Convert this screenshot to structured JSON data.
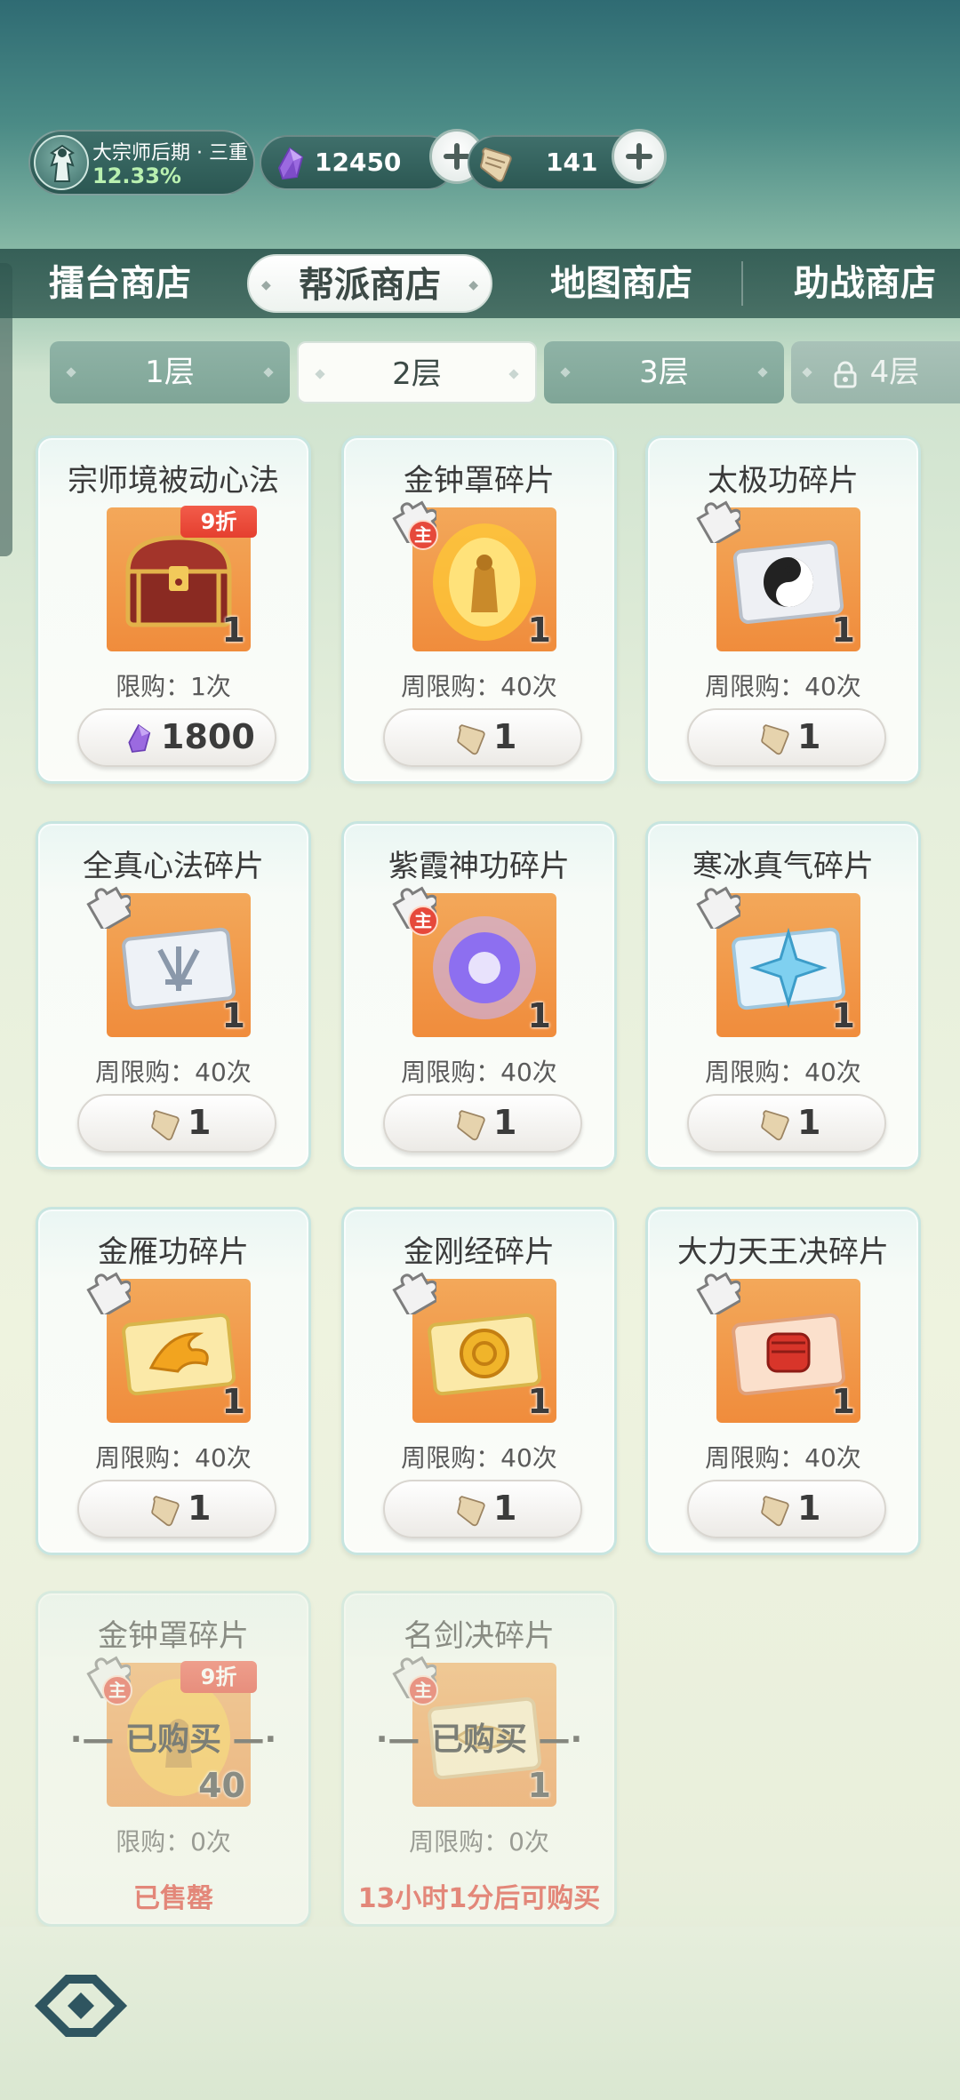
{
  "profile": {
    "rank": "大宗师后期 · 三重",
    "progress": "12.33%"
  },
  "currencies": [
    {
      "name": "purple-gem",
      "value": "12450"
    },
    {
      "name": "scroll-token",
      "value": "141"
    }
  ],
  "shop_tabs": [
    {
      "label": "擂台商店",
      "active": false
    },
    {
      "label": "帮派商店",
      "active": true
    },
    {
      "label": "地图商店",
      "active": false
    },
    {
      "label": "助战商店",
      "active": false
    }
  ],
  "floor_tabs": [
    {
      "label": "1层",
      "active": false,
      "locked": false
    },
    {
      "label": "2层",
      "active": true,
      "locked": false
    },
    {
      "label": "3层",
      "active": false,
      "locked": false
    },
    {
      "label": "4层",
      "active": false,
      "locked": true
    }
  ],
  "items": [
    {
      "title": "宗师境被动心法",
      "qty": "1",
      "limit": "限购：1次",
      "price": "1800",
      "currency": "purple-gem",
      "discount": "9折",
      "icon": "treasure-chest-icon"
    },
    {
      "title": "金钟罩碎片",
      "qty": "1",
      "limit": "周限购：40次",
      "price": "1",
      "currency": "scroll-token",
      "main_badge": "主",
      "icon": "golden-bell-icon"
    },
    {
      "title": "太极功碎片",
      "qty": "1",
      "limit": "周限购：40次",
      "price": "1",
      "currency": "scroll-token",
      "icon": "taiji-scroll-icon"
    },
    {
      "title": "全真心法碎片",
      "qty": "1",
      "limit": "周限购：40次",
      "price": "1",
      "currency": "scroll-token",
      "icon": "silver-scroll-icon"
    },
    {
      "title": "紫霞神功碎片",
      "qty": "1",
      "limit": "周限购：40次",
      "price": "1",
      "currency": "scroll-token",
      "main_badge": "主",
      "icon": "purple-orb-icon"
    },
    {
      "title": "寒冰真气碎片",
      "qty": "1",
      "limit": "周限购：40次",
      "price": "1",
      "currency": "scroll-token",
      "icon": "ice-scroll-icon"
    },
    {
      "title": "金雁功碎片",
      "qty": "1",
      "limit": "周限购：40次",
      "price": "1",
      "currency": "scroll-token",
      "icon": "golden-bird-scroll-icon"
    },
    {
      "title": "金刚经碎片",
      "qty": "1",
      "limit": "周限购：40次",
      "price": "1",
      "currency": "scroll-token",
      "icon": "golden-sutra-scroll-icon"
    },
    {
      "title": "大力天王决碎片",
      "qty": "1",
      "limit": "周限购：40次",
      "price": "1",
      "currency": "scroll-token",
      "icon": "red-fist-scroll-icon"
    },
    {
      "title": "金钟罩碎片",
      "qty": "40",
      "limit": "限购：0次",
      "status": "已售罄",
      "purchased": "已购买",
      "discount": "9折",
      "main_badge": "主",
      "icon": "golden-bell-icon"
    },
    {
      "title": "名剑决碎片",
      "qty": "1",
      "limit": "周限购：0次",
      "status": "13小时1分后可购买",
      "purchased": "已购买",
      "main_badge": "主",
      "icon": "sword-scroll-icon"
    }
  ],
  "colors": {
    "accent_green": "#2f6b73",
    "price_orange": "#f08c3c",
    "discount_red": "#e53f2f",
    "status_red": "#e0332a"
  }
}
